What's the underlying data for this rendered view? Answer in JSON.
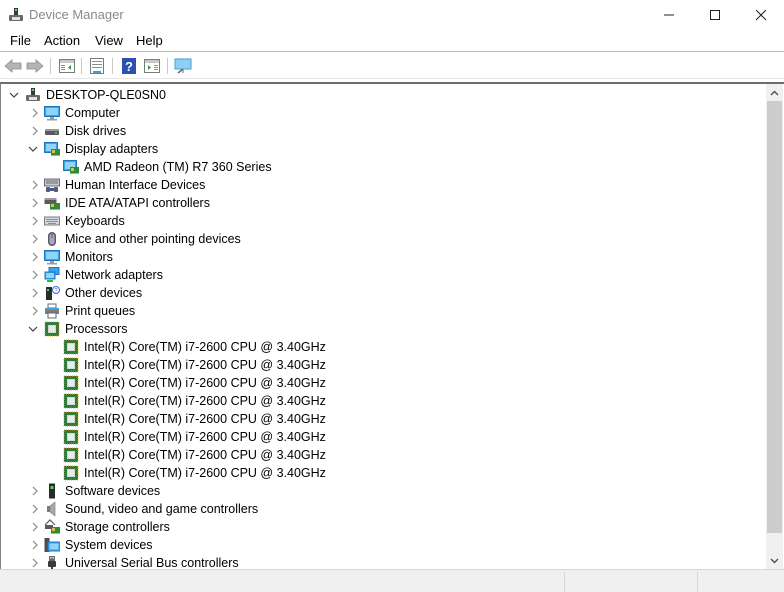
{
  "window": {
    "title": "Device Manager",
    "controls": [
      "minimize",
      "maximize",
      "close"
    ]
  },
  "menubar": {
    "items": [
      {
        "label": "File"
      },
      {
        "label": "Action"
      },
      {
        "label": "View"
      },
      {
        "label": "Help"
      }
    ]
  },
  "toolbar": {
    "buttons": [
      {
        "name": "back",
        "icon": "back-arrow-icon",
        "enabled": false
      },
      {
        "name": "forward",
        "icon": "forward-arrow-icon",
        "enabled": false
      },
      {
        "name": "show-hide-console-tree",
        "icon": "console-tree-icon"
      },
      {
        "name": "properties",
        "icon": "properties-icon"
      },
      {
        "name": "help",
        "icon": "help-icon"
      },
      {
        "name": "show-action-pane",
        "icon": "action-pane-icon"
      },
      {
        "name": "scan-hardware-changes",
        "icon": "scan-monitor-icon"
      }
    ]
  },
  "tree": {
    "root": {
      "label": "DESKTOP-QLE0SN0",
      "icon": "computer-tower-icon",
      "expanded": true
    },
    "categories": [
      {
        "label": "Computer",
        "icon": "computer-icon",
        "expanded": false,
        "children": []
      },
      {
        "label": "Disk drives",
        "icon": "disk-drive-icon",
        "expanded": false,
        "children": []
      },
      {
        "label": "Display adapters",
        "icon": "display-adapter-icon",
        "expanded": true,
        "children": [
          {
            "label": "AMD Radeon (TM) R7 360 Series",
            "icon": "display-adapter-icon"
          }
        ]
      },
      {
        "label": "Human Interface Devices",
        "icon": "hid-icon",
        "expanded": false,
        "children": []
      },
      {
        "label": "IDE ATA/ATAPI controllers",
        "icon": "ide-controller-icon",
        "expanded": false,
        "children": []
      },
      {
        "label": "Keyboards",
        "icon": "keyboard-icon",
        "expanded": false,
        "children": []
      },
      {
        "label": "Mice and other pointing devices",
        "icon": "mouse-icon",
        "expanded": false,
        "children": []
      },
      {
        "label": "Monitors",
        "icon": "monitor-icon",
        "expanded": false,
        "children": []
      },
      {
        "label": "Network adapters",
        "icon": "network-adapter-icon",
        "expanded": false,
        "children": []
      },
      {
        "label": "Other devices",
        "icon": "other-devices-icon",
        "expanded": false,
        "children": []
      },
      {
        "label": "Print queues",
        "icon": "printer-icon",
        "expanded": false,
        "children": []
      },
      {
        "label": "Processors",
        "icon": "processor-icon",
        "expanded": true,
        "children": [
          {
            "label": "Intel(R) Core(TM) i7-2600 CPU @ 3.40GHz",
            "icon": "processor-icon"
          },
          {
            "label": "Intel(R) Core(TM) i7-2600 CPU @ 3.40GHz",
            "icon": "processor-icon"
          },
          {
            "label": "Intel(R) Core(TM) i7-2600 CPU @ 3.40GHz",
            "icon": "processor-icon"
          },
          {
            "label": "Intel(R) Core(TM) i7-2600 CPU @ 3.40GHz",
            "icon": "processor-icon"
          },
          {
            "label": "Intel(R) Core(TM) i7-2600 CPU @ 3.40GHz",
            "icon": "processor-icon"
          },
          {
            "label": "Intel(R) Core(TM) i7-2600 CPU @ 3.40GHz",
            "icon": "processor-icon"
          },
          {
            "label": "Intel(R) Core(TM) i7-2600 CPU @ 3.40GHz",
            "icon": "processor-icon"
          },
          {
            "label": "Intel(R) Core(TM) i7-2600 CPU @ 3.40GHz",
            "icon": "processor-icon"
          }
        ]
      },
      {
        "label": "Software devices",
        "icon": "software-device-icon",
        "expanded": false,
        "children": []
      },
      {
        "label": "Sound, video and game controllers",
        "icon": "speaker-icon",
        "expanded": false,
        "children": []
      },
      {
        "label": "Storage controllers",
        "icon": "storage-controller-icon",
        "expanded": false,
        "children": []
      },
      {
        "label": "System devices",
        "icon": "system-devices-icon",
        "expanded": false,
        "children": []
      },
      {
        "label": "Universal Serial Bus controllers",
        "icon": "usb-icon",
        "expanded": false,
        "children": []
      }
    ]
  },
  "colors": {
    "title_text": "#8a8a8a",
    "chrome_bg": "#f0f0f0",
    "scroll_thumb": "#cdcdcd",
    "chevron": "#6e6e6e"
  },
  "statusbar": {
    "sections": [
      "",
      "",
      ""
    ]
  }
}
